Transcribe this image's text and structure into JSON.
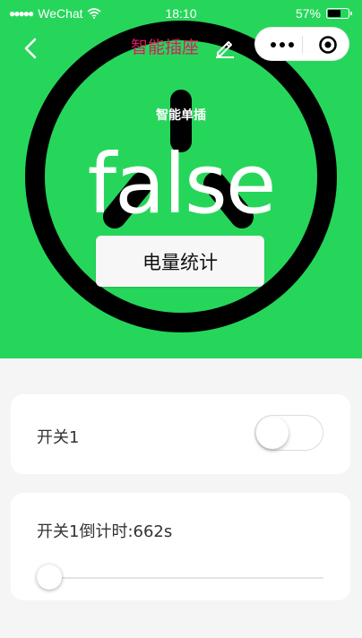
{
  "status_bar": {
    "signal": "●●●●●",
    "carrier": "WeChat",
    "time": "18:10",
    "battery_text": "57%",
    "battery_level": 0.57
  },
  "nav": {
    "title": "智能插座",
    "title_color": "#d81b60"
  },
  "hero": {
    "background_color": "#26d65a",
    "device_label": "智能单插",
    "state_text": "false",
    "stats_button_label": "电量统计"
  },
  "switch_card": {
    "label": "开关1",
    "checked": false
  },
  "timer_card": {
    "label": "开关1倒计时:662s",
    "slider_value": 0
  },
  "colors": {
    "page_background": "#f5f5f5",
    "card_background": "#ffffff",
    "slider_active": "#1aad19"
  }
}
